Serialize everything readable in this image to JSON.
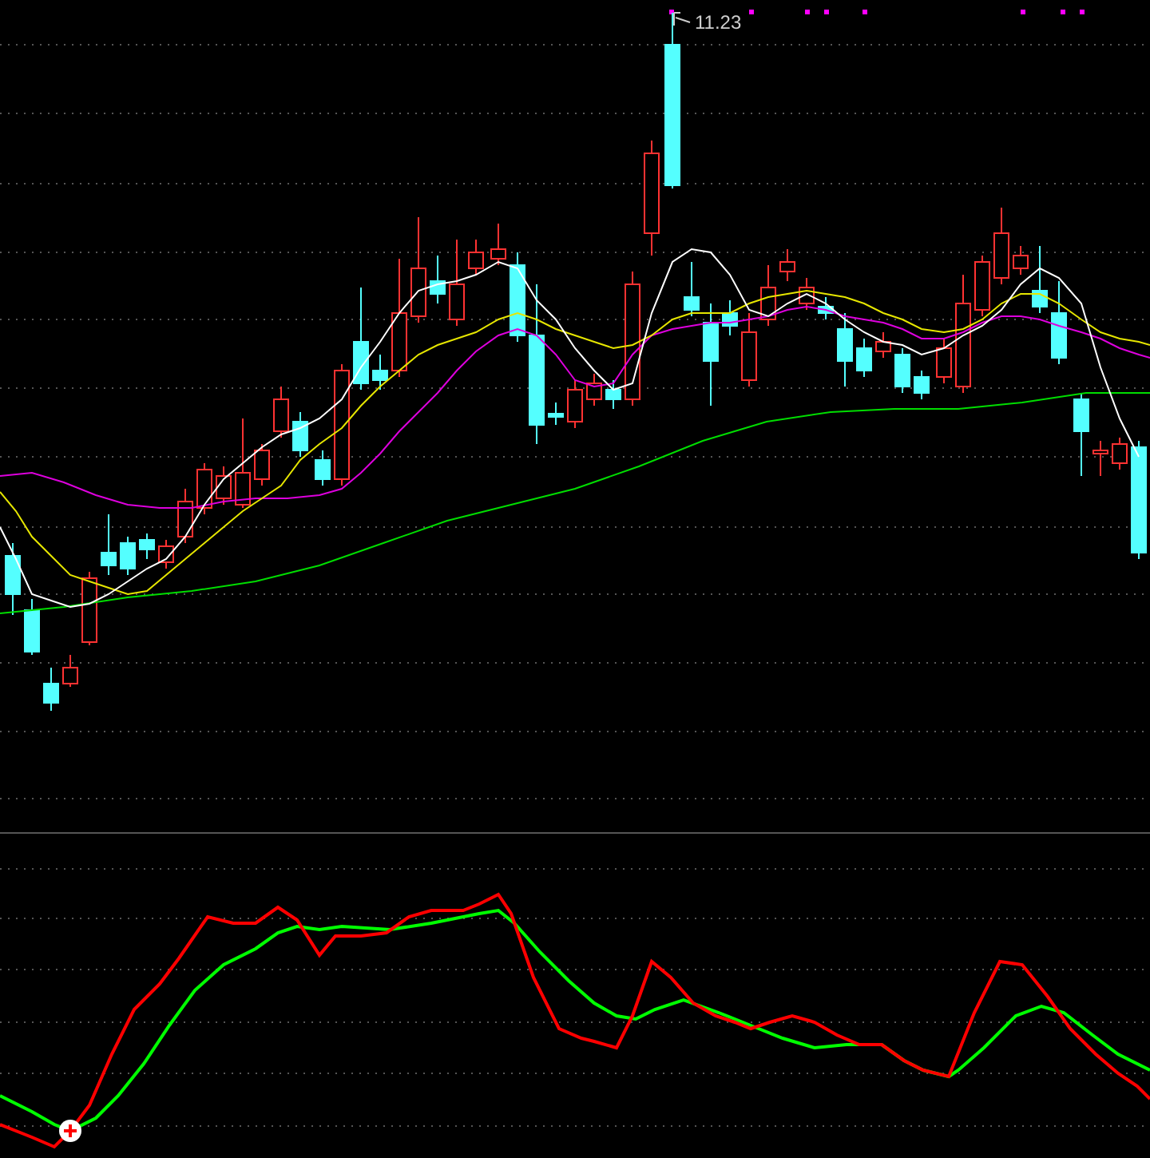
{
  "price_chart": {
    "high_label": "11.23"
  }
}
